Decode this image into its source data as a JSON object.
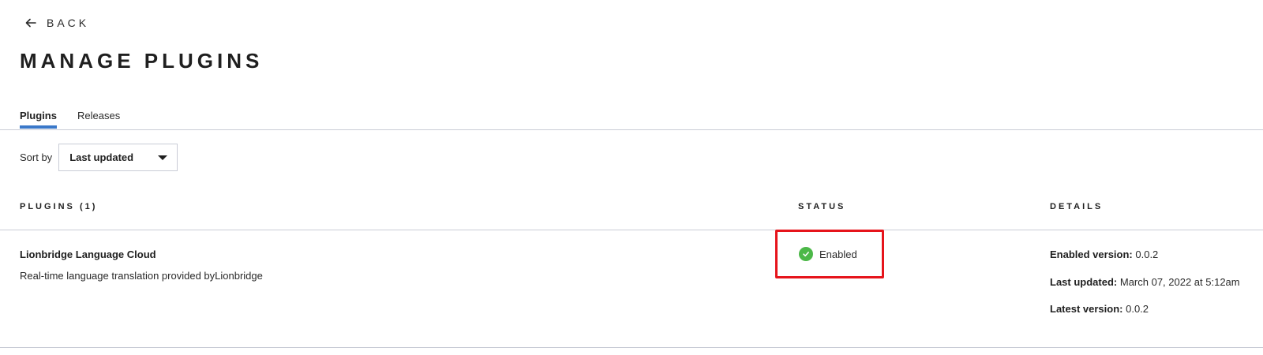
{
  "nav": {
    "back_label": "BACK"
  },
  "page": {
    "title": "MANAGE PLUGINS"
  },
  "tabs": [
    {
      "label": "Plugins",
      "active": true
    },
    {
      "label": "Releases",
      "active": false
    }
  ],
  "sort": {
    "label": "Sort by",
    "value": "Last updated"
  },
  "table": {
    "headers": {
      "plugins": "PLUGINS (1)",
      "status": "STATUS",
      "details": "DETAILS"
    },
    "rows": [
      {
        "name": "Lionbridge Language Cloud",
        "description": "Real-time language translation provided byLionbridge",
        "status": "Enabled",
        "details": {
          "enabled_version_label": "Enabled version:",
          "enabled_version": "0.0.2",
          "last_updated_label": "Last updated:",
          "last_updated": "March 07, 2022 at 5:12am",
          "latest_version_label": "Latest version:",
          "latest_version": "0.0.2"
        }
      }
    ]
  },
  "colors": {
    "accent": "#3a78c9",
    "status_enabled": "#4cb848",
    "highlight": "#e6141b"
  },
  "icons": {
    "back": "arrow-left-icon",
    "status": "check-circle-icon",
    "select": "caret-down-icon"
  }
}
